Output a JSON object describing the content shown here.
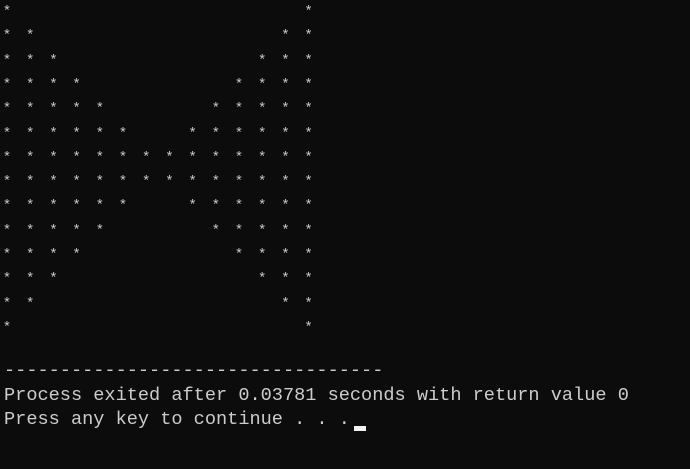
{
  "console": {
    "pattern": {
      "glyph": "*",
      "rows": 14,
      "size": 14
    },
    "separator": "----------------------------------",
    "process_line": "Process exited after 0.03781 seconds with return value 0",
    "press_line": "Press any key to continue . . .",
    "colors": {
      "background": "#0c0c0c",
      "text": "#cccccc",
      "cursor": "#f2f2f2"
    }
  }
}
